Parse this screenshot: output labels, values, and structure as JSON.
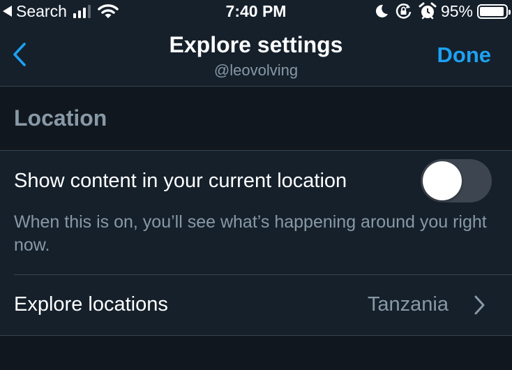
{
  "status_bar": {
    "back_app": "Search",
    "time": "7:40 PM",
    "battery_pct": "95%",
    "battery_level": 0.95,
    "signal_bars": 3,
    "signal_bars_total": 4,
    "icons": [
      "back-triangle-icon",
      "signal-icon",
      "wifi-icon",
      "moon-icon",
      "rotation-lock-icon",
      "alarm-icon",
      "battery-icon"
    ]
  },
  "nav": {
    "title": "Explore settings",
    "subtitle": "@leovolving",
    "done_label": "Done",
    "back_icon": "chevron-left-icon"
  },
  "section": {
    "title": "Location"
  },
  "settings": {
    "show_location": {
      "label": "Show content in your current location",
      "description": "When this is on, you’ll see what’s happening around you right now.",
      "enabled": false
    },
    "explore_locations": {
      "label": "Explore locations",
      "value": "Tanzania",
      "icon": "chevron-right-icon"
    }
  },
  "colors": {
    "background": "#15202b",
    "section_background": "#10171e",
    "accent": "#1da1f2",
    "secondary_text": "#8899a6",
    "divider": "#38444d",
    "toggle_off": "#3d4650"
  }
}
